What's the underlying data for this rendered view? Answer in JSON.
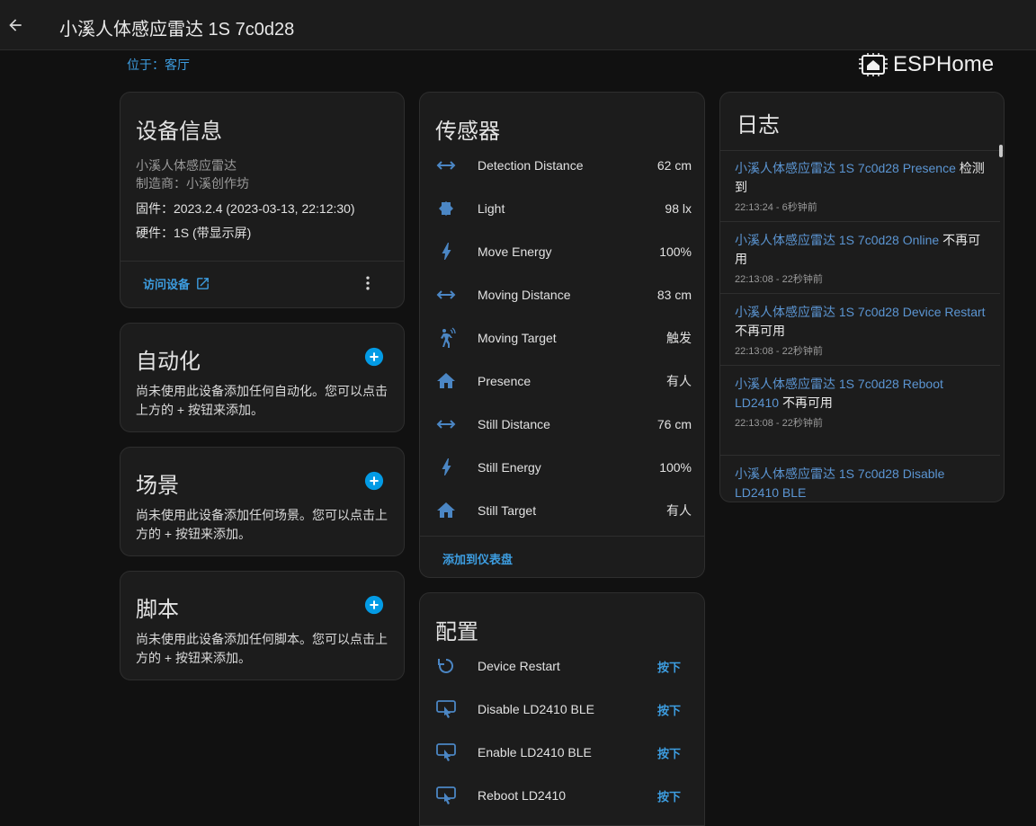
{
  "header": {
    "title": "小溪人体感应雷达 1S 7c0d28"
  },
  "location": "位于：客厅",
  "brand": {
    "name": "ESPHome"
  },
  "device_info": {
    "title": "设备信息",
    "model": "小溪人体感应雷达",
    "manufacturer": "制造商：小溪创作坊",
    "firmware": "固件：2023.2.4 (2023-03-13, 22:12:30)",
    "hardware": "硬件：1S (带显示屏)",
    "visit_label": "访问设备"
  },
  "automation": {
    "title": "自动化",
    "description": "尚未使用此设备添加任何自动化。您可以点击上方的 + 按钮来添加。"
  },
  "scene": {
    "title": "场景",
    "description": "尚未使用此设备添加任何场景。您可以点击上方的 + 按钮来添加。"
  },
  "script": {
    "title": "脚本",
    "description": "尚未使用此设备添加任何脚本。您可以点击上方的 + 按钮来添加。"
  },
  "sensors": {
    "title": "传感器",
    "items": [
      {
        "icon": "arrow-left-right-icon",
        "name": "Detection Distance",
        "value": "62 cm"
      },
      {
        "icon": "brightness-icon",
        "name": "Light",
        "value": "98 lx"
      },
      {
        "icon": "lightning-bolt-icon",
        "name": "Move Energy",
        "value": "100%"
      },
      {
        "icon": "arrow-left-right-icon",
        "name": "Moving Distance",
        "value": "83 cm"
      },
      {
        "icon": "motion-sensor-icon",
        "name": "Moving Target",
        "value": "触发"
      },
      {
        "icon": "home-icon",
        "name": "Presence",
        "value": "有人"
      },
      {
        "icon": "arrow-left-right-icon",
        "name": "Still Distance",
        "value": "76 cm"
      },
      {
        "icon": "lightning-bolt-icon",
        "name": "Still Energy",
        "value": "100%"
      },
      {
        "icon": "home-icon",
        "name": "Still Target",
        "value": "有人"
      }
    ],
    "add_to_dashboard": "添加到仪表盘"
  },
  "config": {
    "title": "配置",
    "items": [
      {
        "icon": "restart-icon",
        "name": "Device Restart",
        "action": "按下"
      },
      {
        "icon": "gesture-tap-button-icon",
        "name": "Disable LD2410 BLE",
        "action": "按下"
      },
      {
        "icon": "gesture-tap-button-icon",
        "name": "Enable LD2410 BLE",
        "action": "按下"
      },
      {
        "icon": "gesture-tap-button-icon",
        "name": "Reboot LD2410",
        "action": "按下"
      }
    ]
  },
  "logbook": {
    "title": "日志",
    "entries": [
      {
        "entity": "小溪人体感应雷达 1S 7c0d28 Presence",
        "state": "检测到",
        "time": "22:13:24 - 6秒钟前"
      },
      {
        "entity": "小溪人体感应雷达 1S 7c0d28 Online",
        "state": "不再可用",
        "time": "22:13:08 - 22秒钟前"
      },
      {
        "entity": "小溪人体感应雷达 1S 7c0d28 Device Restart",
        "state": "不再可用",
        "time": "22:13:08 - 22秒钟前"
      },
      {
        "entity": "小溪人体感应雷达 1S 7c0d28 Reboot LD2410",
        "state": "不再可用",
        "time": "22:13:08 - 22秒钟前"
      },
      {
        "entity": "小溪人体感应雷达 1S 7c0d28 Disable LD2410 BLE",
        "state": "",
        "time": ""
      }
    ]
  },
  "colors": {
    "accent": "#3d9de0",
    "icon": "#4b86c4",
    "card": "#1c1c1c",
    "background": "#111111"
  }
}
